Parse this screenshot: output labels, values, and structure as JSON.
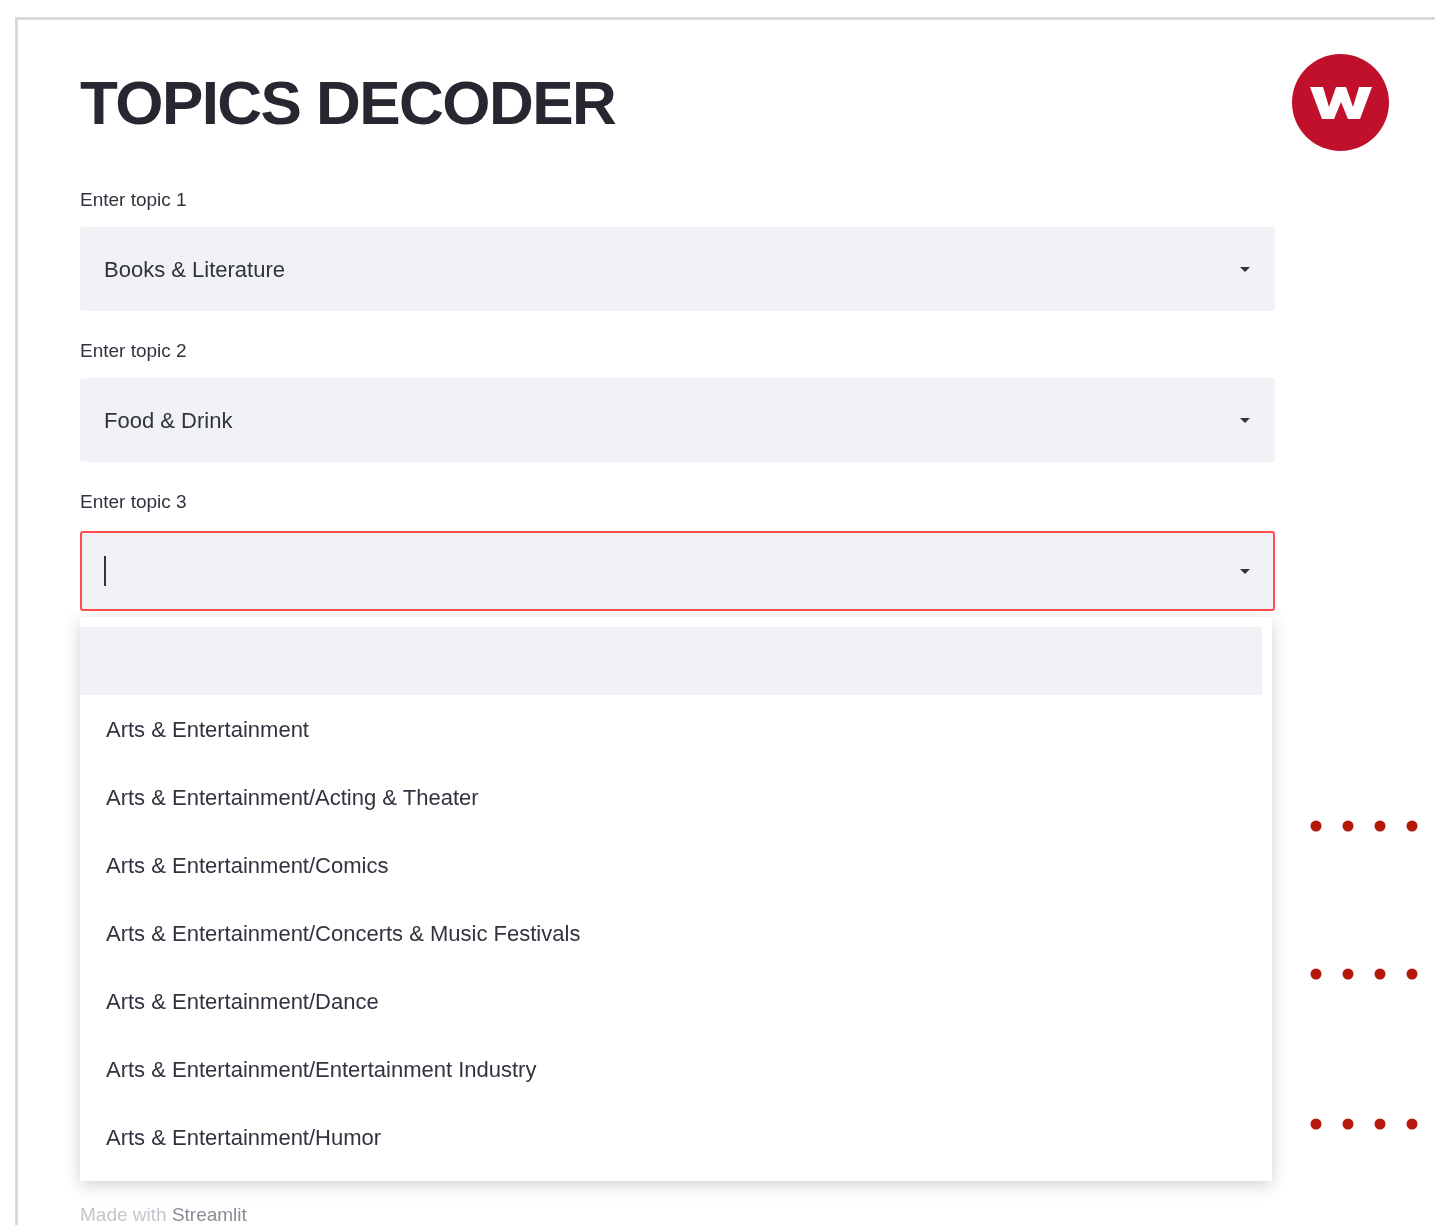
{
  "title": "TOPICS DECODER",
  "fields": [
    {
      "label": "Enter topic 1",
      "value": "Books & Literature",
      "focused": false
    },
    {
      "label": "Enter topic 2",
      "value": "Food & Drink",
      "focused": false
    },
    {
      "label": "Enter topic 3",
      "focused": true
    }
  ],
  "dropdown": {
    "options": [
      {
        "selected": true
      },
      {
        "label": "Arts & Entertainment",
        "selected": false
      },
      {
        "label": "Arts & Entertainment/Acting & Theater",
        "selected": false
      },
      {
        "label": "Arts & Entertainment/Comics",
        "selected": false
      },
      {
        "label": "Arts & Entertainment/Concerts & Music Festivals",
        "selected": false
      },
      {
        "label": "Arts & Entertainment/Dance",
        "selected": false
      },
      {
        "label": "Arts & Entertainment/Entertainment Industry",
        "selected": false
      },
      {
        "label": "Arts & Entertainment/Humor",
        "selected": false
      }
    ]
  },
  "footer": "Made with **Streamlit**"
}
